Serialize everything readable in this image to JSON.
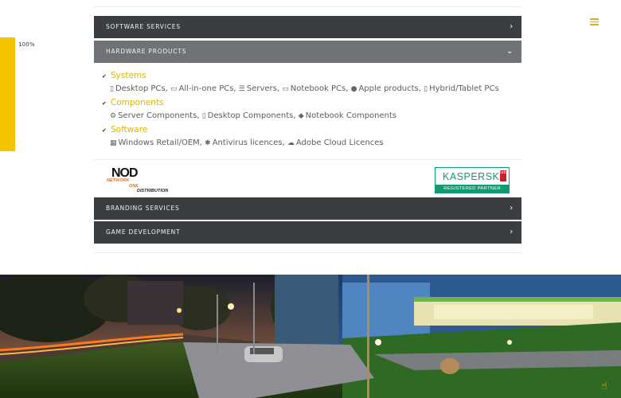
{
  "progress": {
    "label": "100%",
    "value": 100
  },
  "accordion": [
    {
      "label": "SOFTWARE SERVICES",
      "state": "collapsed"
    },
    {
      "label": "HARDWARE PRODUCTS",
      "state": "expanded"
    },
    {
      "label": "BRANDING SERVICES",
      "state": "collapsed"
    },
    {
      "label": "GAME DEVELOPMENT",
      "state": "collapsed"
    }
  ],
  "hardware": {
    "systems": {
      "title": "Systems",
      "items": [
        {
          "icon": "desktop-icon",
          "label": "Desktop PCs,"
        },
        {
          "icon": "monitor-icon",
          "label": "All-in-one PCs,"
        },
        {
          "icon": "server-icon",
          "label": "Servers,"
        },
        {
          "icon": "laptop-icon",
          "label": "Notebook PCs,"
        },
        {
          "icon": "apple-icon",
          "label": "Apple products,"
        },
        {
          "icon": "tablet-icon",
          "label": "Hybrid/Tablet PCs"
        }
      ]
    },
    "components": {
      "title": "Components",
      "items": [
        {
          "icon": "cogs-icon",
          "label": "Server Components,"
        },
        {
          "icon": "desktop-icon",
          "label": "Desktop Components,"
        },
        {
          "icon": "cubes-icon",
          "label": "Notebook Components"
        }
      ]
    },
    "software": {
      "title": "Software",
      "items": [
        {
          "icon": "windows-icon",
          "label": "Windows Retail/OEM,"
        },
        {
          "icon": "bug-icon",
          "label": "Antivirus licences,"
        },
        {
          "icon": "cloud-icon",
          "label": "Adobe Cloud Licences"
        }
      ]
    }
  },
  "partners": {
    "nod": {
      "main": "NOD",
      "line1": "NETWORK",
      "line2": "ONE",
      "line3": "DISTRIBUTION"
    },
    "kaspersky": {
      "name": "KASPERSKY",
      "badge": "lab",
      "tagline": "REGISTERED PARTNER"
    }
  },
  "colors": {
    "accent": "#f4c400",
    "bar_dark": "#3b3e41",
    "bar_open": "#6f7276",
    "kaspersky_green": "#149a73"
  }
}
